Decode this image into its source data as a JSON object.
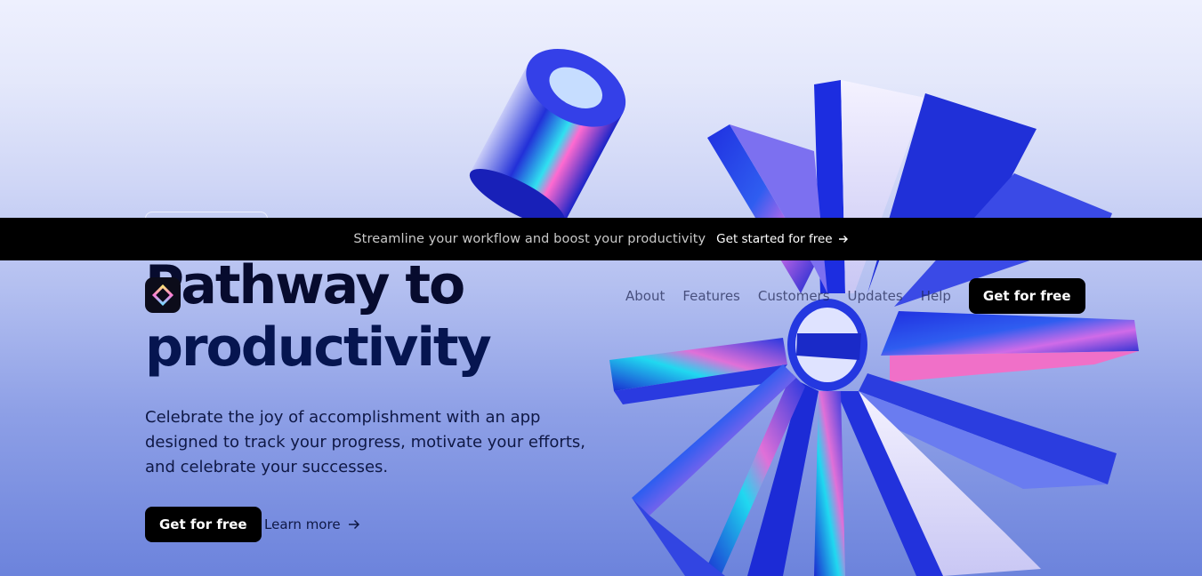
{
  "banner": {
    "text": "Streamline your workflow and boost your productivity",
    "link_label": "Get started for free"
  },
  "nav": {
    "items": [
      {
        "label": "About"
      },
      {
        "label": "Features"
      },
      {
        "label": "Customers"
      },
      {
        "label": "Updates"
      },
      {
        "label": "Help"
      }
    ],
    "cta_label": "Get for free"
  },
  "hero": {
    "headline_line1": "Pathway to",
    "headline_line2": "productivity",
    "subtitle": "Celebrate the joy of accomplishment with an app designed to track your progress, motivate your efforts, and celebrate your successes.",
    "primary_cta": "Get for free",
    "secondary_cta": "Learn more"
  },
  "colors": {
    "accent_blue": "#1a2fd8",
    "headline": "#061550",
    "button_bg": "#000000",
    "banner_bg": "#000000"
  },
  "icons": {
    "logo": "diamond-logo-icon",
    "arrow": "arrow-right-icon"
  }
}
